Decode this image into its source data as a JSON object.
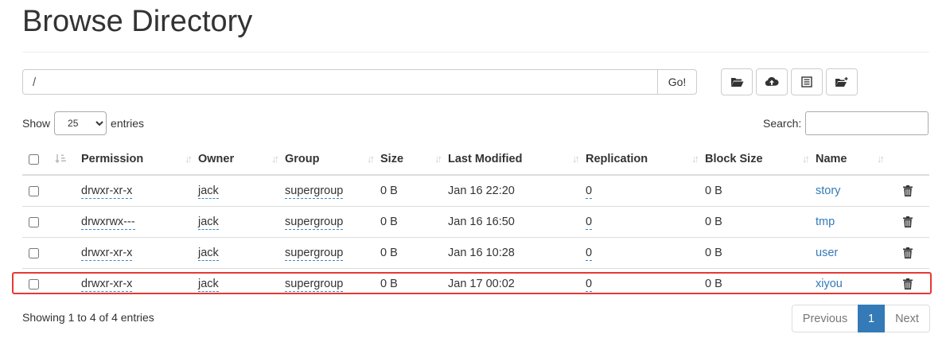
{
  "page": {
    "title": "Browse Directory"
  },
  "path_bar": {
    "path_value": "/",
    "go_label": "Go!"
  },
  "toolbar": {
    "buttons": [
      "open-folder-icon",
      "upload-icon",
      "list-icon",
      "create-folder-icon"
    ]
  },
  "entries": {
    "show_label": "Show",
    "selected": "25",
    "entries_label": "entries",
    "search_label": "Search:"
  },
  "table": {
    "columns": [
      "Permission",
      "Owner",
      "Group",
      "Size",
      "Last Modified",
      "Replication",
      "Block Size",
      "Name"
    ],
    "rows": [
      {
        "permission": "drwxr-xr-x",
        "owner": "jack",
        "group": "supergroup",
        "size": "0 B",
        "modified": "Jan 16 22:20",
        "replication": "0",
        "block_size": "0 B",
        "name": "story"
      },
      {
        "permission": "drwxrwx---",
        "owner": "jack",
        "group": "supergroup",
        "size": "0 B",
        "modified": "Jan 16 16:50",
        "replication": "0",
        "block_size": "0 B",
        "name": "tmp"
      },
      {
        "permission": "drwxr-xr-x",
        "owner": "jack",
        "group": "supergroup",
        "size": "0 B",
        "modified": "Jan 16 10:28",
        "replication": "0",
        "block_size": "0 B",
        "name": "user"
      },
      {
        "permission": "drwxr-xr-x",
        "owner": "jack",
        "group": "supergroup",
        "size": "0 B",
        "modified": "Jan 17 00:02",
        "replication": "0",
        "block_size": "0 B",
        "name": "xiyou"
      }
    ]
  },
  "footer": {
    "info": "Showing 1 to 4 of 4 entries",
    "previous": "Previous",
    "current_page": "1",
    "next": "Next"
  },
  "colors": {
    "accent": "#337ab7",
    "highlight": "#e53935"
  }
}
